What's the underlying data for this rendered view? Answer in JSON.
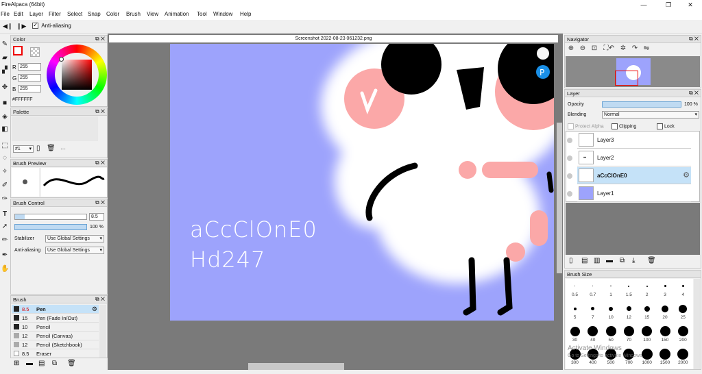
{
  "window": {
    "title": "FireAlpaca (64bit)",
    "min": "—",
    "max": "❐",
    "close": "✕"
  },
  "menu": [
    "File",
    "Edit",
    "Layer",
    "Filter",
    "Select",
    "Snap",
    "Color",
    "Brush",
    "View",
    "Animation",
    "Tool",
    "Window",
    "Help"
  ],
  "tool_options": {
    "antialias_label": "Anti-aliasing"
  },
  "color_panel": {
    "title": "Color",
    "r_label": "R",
    "g_label": "G",
    "b_label": "B",
    "r": "255",
    "g": "255",
    "b": "255",
    "hex": "#FFFFFF"
  },
  "palette_panel": {
    "title": "Palette",
    "selector": "#1",
    "more": "···"
  },
  "brush_preview": {
    "title": "Brush Preview"
  },
  "brush_control": {
    "title": "Brush Control",
    "size": "8.5",
    "opacity": "100 %",
    "stabilizer_label": "Stabilizer",
    "stabilizer_value": "Use Global Settings",
    "antialias_label": "Anti-aliasing",
    "antialias_value": "Use Global Settings"
  },
  "brush_panel": {
    "title": "Brush",
    "items": [
      {
        "size": "8.5",
        "name": "Pen"
      },
      {
        "size": "15",
        "name": "Pen (Fade In/Out)"
      },
      {
        "size": "10",
        "name": "Pencil"
      },
      {
        "size": "12",
        "name": "Pencil (Canvas)"
      },
      {
        "size": "12",
        "name": "Pencil (Sketchbook)"
      },
      {
        "size": "8.5",
        "name": "Eraser"
      }
    ]
  },
  "document": {
    "tab_title": "Screenshot 2022-08-23 061232.png",
    "text_line1": "aCcClOnE0",
    "text_line2": "Hd247"
  },
  "navigator": {
    "title": "Navigator"
  },
  "layer_panel": {
    "title": "Layer",
    "opacity_label": "Opacity",
    "opacity_value": "100 %",
    "blending_label": "Blending",
    "blending_value": "Normal",
    "protect_alpha": "Protect Alpha",
    "clipping": "Clipping",
    "lock": "Lock",
    "layers": [
      {
        "name": "Layer3",
        "selected": false
      },
      {
        "name": "Layer2",
        "selected": false
      },
      {
        "name": "aCcClOnE0",
        "selected": true
      },
      {
        "name": "Layer1",
        "selected": false
      }
    ]
  },
  "brush_size": {
    "title": "Brush Size",
    "sizes": [
      "0.5",
      "0.7",
      "1",
      "1.5",
      "2",
      "3",
      "4",
      "5",
      "7",
      "10",
      "12",
      "15",
      "20",
      "25",
      "30",
      "40",
      "50",
      "70",
      "100",
      "150",
      "200",
      "300",
      "400",
      "500",
      "700",
      "1000",
      "1500",
      "2000"
    ],
    "watermark_line1": "Activate Windows",
    "watermark_line2": "Go to Settings to activate Windows."
  },
  "colors": {
    "canvas": "#9da3fc",
    "selection": "#c5e2f8",
    "accent": "#6aa3d4",
    "fg_swatch": "#ff0000"
  }
}
